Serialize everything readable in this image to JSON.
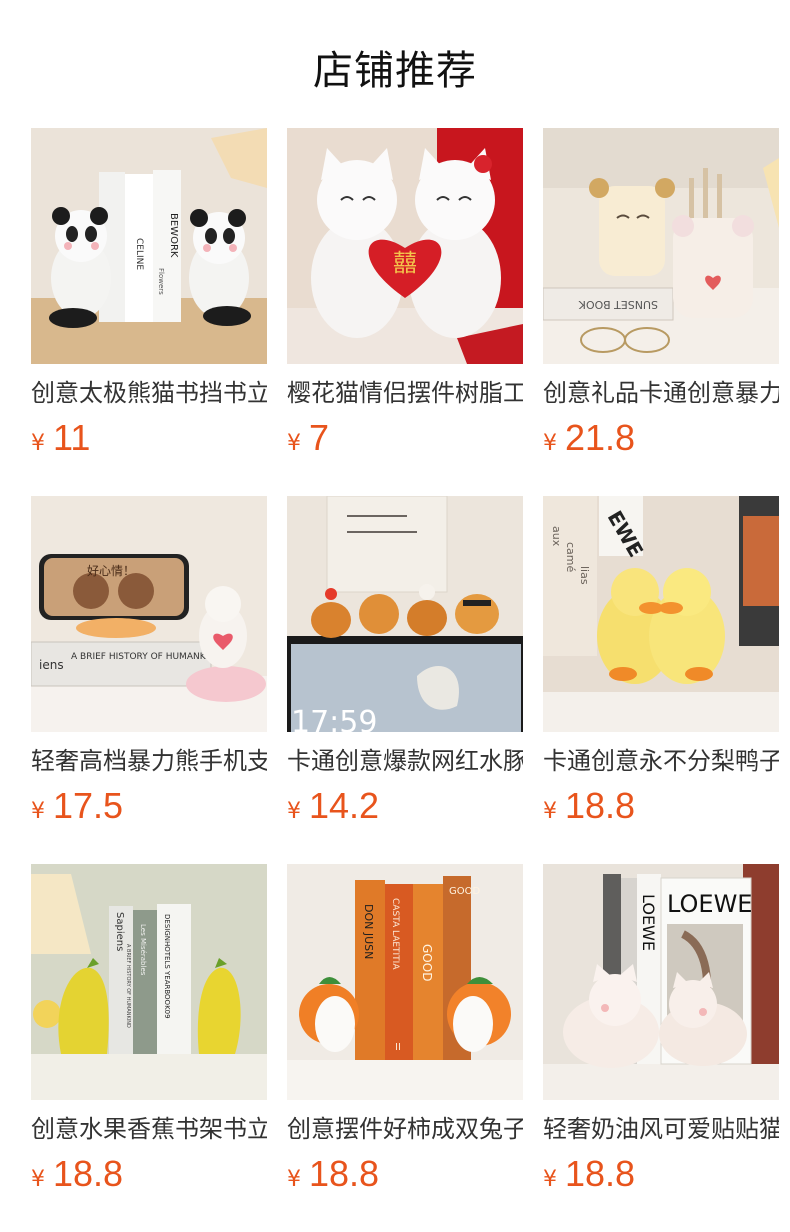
{
  "page": {
    "title": "店铺推荐"
  },
  "currency_symbol": "¥",
  "products": [
    {
      "name": "创意太极熊猫书挡书立",
      "price": "11",
      "image": "panda-bookend-photo",
      "book_texts": [
        "CELINE",
        "Flowers",
        "BEWORK"
      ]
    },
    {
      "name": "樱花猫情侣摆件树脂工艺",
      "price": "7",
      "image": "lucky-cat-couple-photo"
    },
    {
      "name": "创意礼品卡通创意暴力熊",
      "price": "21.8",
      "image": "bear-pen-holder-photo",
      "book_texts": [
        "SUNSET BOOK"
      ]
    },
    {
      "name": "轻奢高档暴力熊手机支架",
      "price": "17.5",
      "image": "bear-phone-stand-photo",
      "book_texts": [
        "A BRIEF HISTORY OF HUMANKIND",
        "iens"
      ],
      "screen_text": "好心情！"
    },
    {
      "name": "卡通创意爆款网红水豚",
      "price": "14.2",
      "image": "capybara-monitor-photo",
      "screen_text": "17:59"
    },
    {
      "name": "卡通创意永不分梨鸭子",
      "price": "18.8",
      "image": "duck-couple-photo",
      "book_texts": [
        "EWE",
        "aux",
        "camé",
        "lias"
      ]
    },
    {
      "name": "创意水果香蕉书架书立",
      "price": "18.8",
      "image": "banana-bookend-photo",
      "book_texts": [
        "Sapiens",
        "A BRIEF HISTORY OF HUMANKIND",
        "Les Misérables",
        "DESIGNHOTELS YEARBOOK09"
      ]
    },
    {
      "name": "创意摆件好柿成双兔子",
      "price": "18.8",
      "image": "persimmon-rabbit-bookend-photo",
      "book_texts": [
        "DON JUSN",
        "CASTA LAETITIA",
        "GOOD",
        "II",
        "GOOD"
      ]
    },
    {
      "name": "轻奢奶油风可爱贴贴猫",
      "price": "18.8",
      "image": "cream-cat-bookend-photo",
      "book_texts": [
        "LOEWE",
        "LOEWE"
      ]
    }
  ]
}
